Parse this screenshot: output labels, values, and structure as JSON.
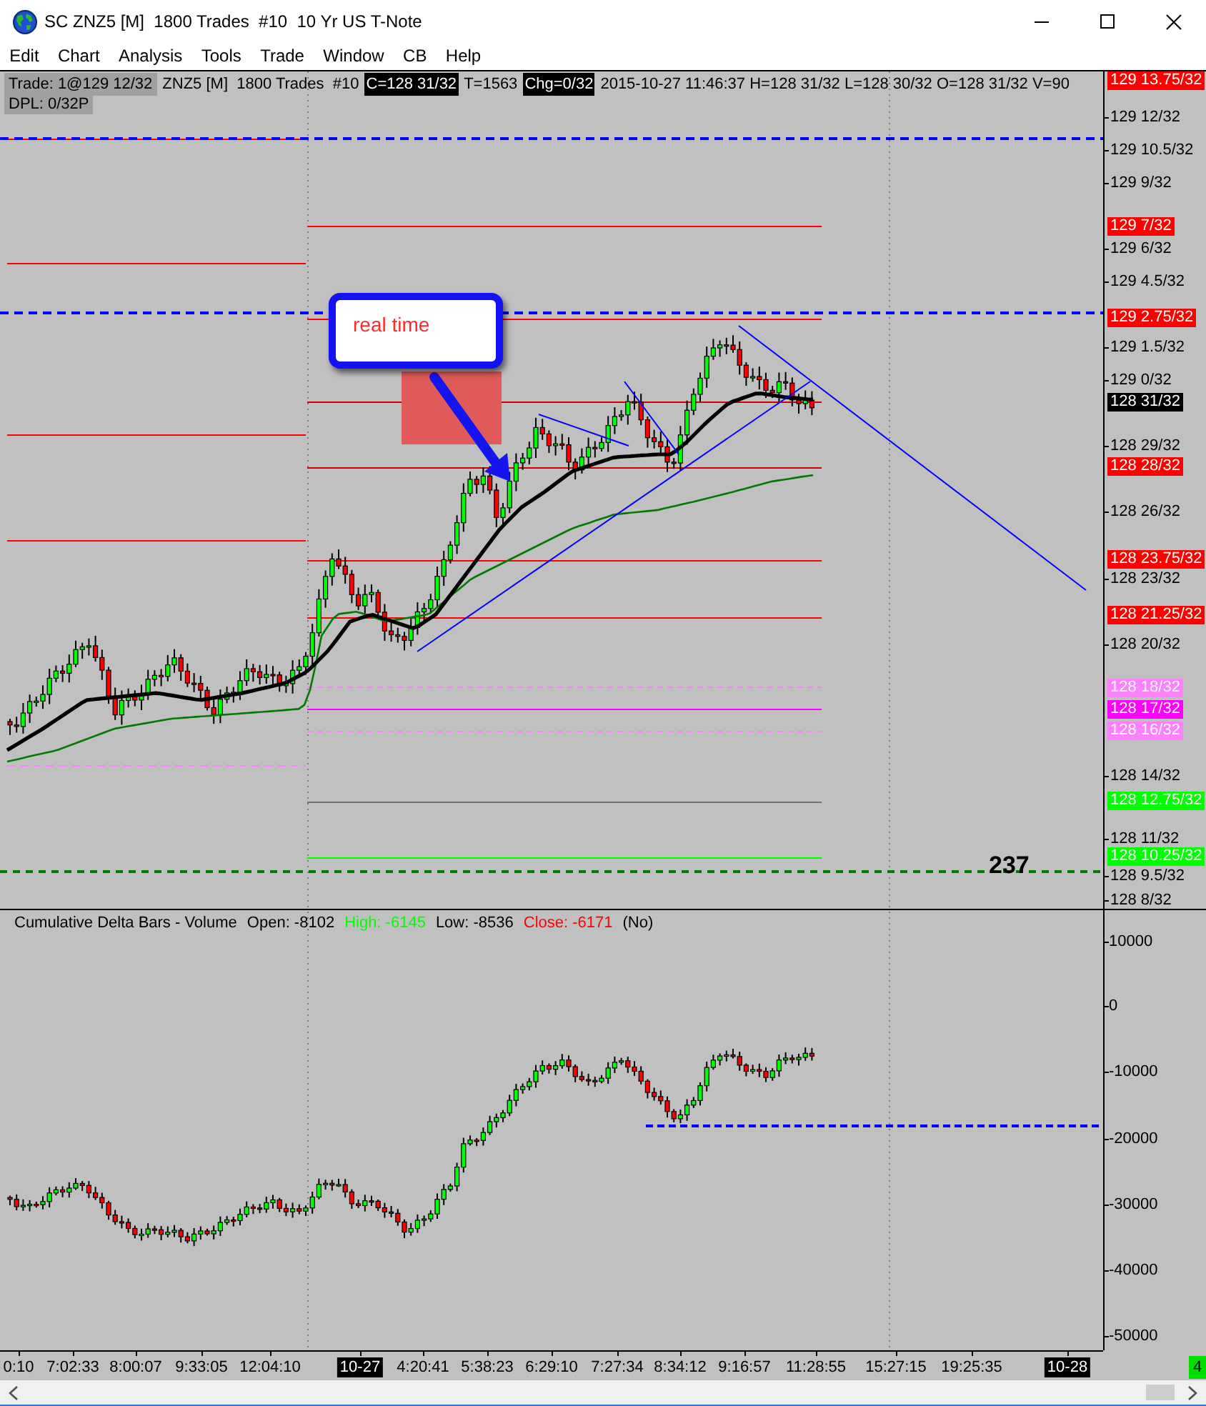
{
  "window": {
    "title": "SC ZNZ5 [M]  1800 Trades  #10  10 Yr US T-Note"
  },
  "menu": [
    "Edit",
    "Chart",
    "Analysis",
    "Tools",
    "Trade",
    "Window",
    "CB",
    "Help"
  ],
  "price_chart": {
    "info_rows": [
      [
        {
          "text": "Trade: 1@129 12/32",
          "kind": "shaded"
        },
        {
          "text": "ZNZ5 [M]  1800 Trades  #10",
          "kind": "plain"
        },
        {
          "text": "C=128 31/32",
          "kind": "inverse"
        },
        {
          "text": "T=1563",
          "kind": "plain"
        },
        {
          "text": "Chg=0/32",
          "kind": "inverse"
        },
        {
          "text": "2015-10-27 11:46:37 H=128 31/32 L=128 30/32 O=128 31/32 V=90",
          "kind": "plain"
        }
      ],
      [
        {
          "text": "DPL: 0/32P",
          "kind": "shaded"
        }
      ]
    ],
    "axis_labels": [
      "129 12/32",
      "129 10.5/32",
      "129 9/32",
      "129 6/32",
      "129 4.5/32",
      "129 1.5/32",
      "129 0/32",
      "128 29/32",
      "128 26/32",
      "128 23/32",
      "128 20/32",
      "128 14/32",
      "128 11/32",
      "128 9.5/32",
      "128 8/32"
    ],
    "price_markers": [
      {
        "text": "129 13.75/32",
        "color": "#ff0000"
      },
      {
        "text": "129 7/32",
        "color": "#ff0000"
      },
      {
        "text": "129 2.75/32",
        "color": "#ff0000"
      },
      {
        "text": "128 31/32",
        "color": "#000000"
      },
      {
        "text": "128 28/32",
        "color": "#ff0000"
      },
      {
        "text": "128 23.75/32",
        "color": "#ff0000"
      },
      {
        "text": "128 21.25/32",
        "color": "#ff0000"
      },
      {
        "text": "128 18/32",
        "color": "#ff80ff"
      },
      {
        "text": "128 17/32",
        "color": "#ff00ff"
      },
      {
        "text": "128 16/32",
        "color": "#ff80ff"
      },
      {
        "text": "128 12.75/32",
        "color": "#00ff00"
      },
      {
        "text": "128 10.25/32",
        "color": "#00ff00"
      }
    ],
    "callout": {
      "text": "real time"
    },
    "counter": "237"
  },
  "delta_panel": {
    "title": "Cumulative Delta Bars - Volume",
    "stats": [
      {
        "text": "Open: -8102",
        "color": "#000000"
      },
      {
        "text": "High: -6145",
        "color": "#00ff00"
      },
      {
        "text": "Low: -8536",
        "color": "#000000"
      },
      {
        "text": "Close: -6171",
        "color": "#ff0000"
      },
      {
        "text": "(No)",
        "color": "#000000"
      }
    ],
    "axis_labels": [
      "10000",
      "0",
      "-10000",
      "-20000",
      "-30000",
      "-40000",
      "-50000"
    ]
  },
  "time_axis": [
    {
      "text": "0:10",
      "kind": "time"
    },
    {
      "text": "7:02:33",
      "kind": "time"
    },
    {
      "text": "8:00:07",
      "kind": "time"
    },
    {
      "text": "9:33:05",
      "kind": "time"
    },
    {
      "text": "12:04:10",
      "kind": "time"
    },
    {
      "text": "10-27",
      "kind": "date"
    },
    {
      "text": "4:20:41",
      "kind": "time"
    },
    {
      "text": "5:38:23",
      "kind": "time"
    },
    {
      "text": "6:29:10",
      "kind": "time"
    },
    {
      "text": "7:27:34",
      "kind": "time"
    },
    {
      "text": "8:34:12",
      "kind": "time"
    },
    {
      "text": "9:16:57",
      "kind": "time"
    },
    {
      "text": "11:28:55",
      "kind": "time"
    },
    {
      "text": "15:27:15",
      "kind": "time"
    },
    {
      "text": "19:25:35",
      "kind": "time"
    },
    {
      "text": "10-28",
      "kind": "date"
    }
  ],
  "status": "4"
}
